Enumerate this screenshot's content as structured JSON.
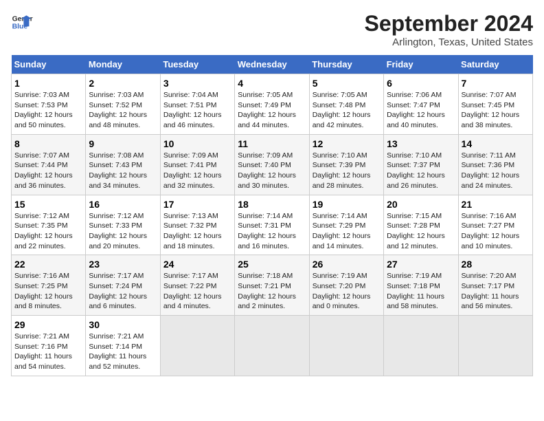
{
  "logo": {
    "line1": "General",
    "line2": "Blue"
  },
  "title": "September 2024",
  "subtitle": "Arlington, Texas, United States",
  "headers": [
    "Sunday",
    "Monday",
    "Tuesday",
    "Wednesday",
    "Thursday",
    "Friday",
    "Saturday"
  ],
  "weeks": [
    [
      {
        "day": "1",
        "info": "Sunrise: 7:03 AM\nSunset: 7:53 PM\nDaylight: 12 hours\nand 50 minutes."
      },
      {
        "day": "2",
        "info": "Sunrise: 7:03 AM\nSunset: 7:52 PM\nDaylight: 12 hours\nand 48 minutes."
      },
      {
        "day": "3",
        "info": "Sunrise: 7:04 AM\nSunset: 7:51 PM\nDaylight: 12 hours\nand 46 minutes."
      },
      {
        "day": "4",
        "info": "Sunrise: 7:05 AM\nSunset: 7:49 PM\nDaylight: 12 hours\nand 44 minutes."
      },
      {
        "day": "5",
        "info": "Sunrise: 7:05 AM\nSunset: 7:48 PM\nDaylight: 12 hours\nand 42 minutes."
      },
      {
        "day": "6",
        "info": "Sunrise: 7:06 AM\nSunset: 7:47 PM\nDaylight: 12 hours\nand 40 minutes."
      },
      {
        "day": "7",
        "info": "Sunrise: 7:07 AM\nSunset: 7:45 PM\nDaylight: 12 hours\nand 38 minutes."
      }
    ],
    [
      {
        "day": "8",
        "info": "Sunrise: 7:07 AM\nSunset: 7:44 PM\nDaylight: 12 hours\nand 36 minutes."
      },
      {
        "day": "9",
        "info": "Sunrise: 7:08 AM\nSunset: 7:43 PM\nDaylight: 12 hours\nand 34 minutes."
      },
      {
        "day": "10",
        "info": "Sunrise: 7:09 AM\nSunset: 7:41 PM\nDaylight: 12 hours\nand 32 minutes."
      },
      {
        "day": "11",
        "info": "Sunrise: 7:09 AM\nSunset: 7:40 PM\nDaylight: 12 hours\nand 30 minutes."
      },
      {
        "day": "12",
        "info": "Sunrise: 7:10 AM\nSunset: 7:39 PM\nDaylight: 12 hours\nand 28 minutes."
      },
      {
        "day": "13",
        "info": "Sunrise: 7:10 AM\nSunset: 7:37 PM\nDaylight: 12 hours\nand 26 minutes."
      },
      {
        "day": "14",
        "info": "Sunrise: 7:11 AM\nSunset: 7:36 PM\nDaylight: 12 hours\nand 24 minutes."
      }
    ],
    [
      {
        "day": "15",
        "info": "Sunrise: 7:12 AM\nSunset: 7:35 PM\nDaylight: 12 hours\nand 22 minutes."
      },
      {
        "day": "16",
        "info": "Sunrise: 7:12 AM\nSunset: 7:33 PM\nDaylight: 12 hours\nand 20 minutes."
      },
      {
        "day": "17",
        "info": "Sunrise: 7:13 AM\nSunset: 7:32 PM\nDaylight: 12 hours\nand 18 minutes."
      },
      {
        "day": "18",
        "info": "Sunrise: 7:14 AM\nSunset: 7:31 PM\nDaylight: 12 hours\nand 16 minutes."
      },
      {
        "day": "19",
        "info": "Sunrise: 7:14 AM\nSunset: 7:29 PM\nDaylight: 12 hours\nand 14 minutes."
      },
      {
        "day": "20",
        "info": "Sunrise: 7:15 AM\nSunset: 7:28 PM\nDaylight: 12 hours\nand 12 minutes."
      },
      {
        "day": "21",
        "info": "Sunrise: 7:16 AM\nSunset: 7:27 PM\nDaylight: 12 hours\nand 10 minutes."
      }
    ],
    [
      {
        "day": "22",
        "info": "Sunrise: 7:16 AM\nSunset: 7:25 PM\nDaylight: 12 hours\nand 8 minutes."
      },
      {
        "day": "23",
        "info": "Sunrise: 7:17 AM\nSunset: 7:24 PM\nDaylight: 12 hours\nand 6 minutes."
      },
      {
        "day": "24",
        "info": "Sunrise: 7:17 AM\nSunset: 7:22 PM\nDaylight: 12 hours\nand 4 minutes."
      },
      {
        "day": "25",
        "info": "Sunrise: 7:18 AM\nSunset: 7:21 PM\nDaylight: 12 hours\nand 2 minutes."
      },
      {
        "day": "26",
        "info": "Sunrise: 7:19 AM\nSunset: 7:20 PM\nDaylight: 12 hours\nand 0 minutes."
      },
      {
        "day": "27",
        "info": "Sunrise: 7:19 AM\nSunset: 7:18 PM\nDaylight: 11 hours\nand 58 minutes."
      },
      {
        "day": "28",
        "info": "Sunrise: 7:20 AM\nSunset: 7:17 PM\nDaylight: 11 hours\nand 56 minutes."
      }
    ],
    [
      {
        "day": "29",
        "info": "Sunrise: 7:21 AM\nSunset: 7:16 PM\nDaylight: 11 hours\nand 54 minutes."
      },
      {
        "day": "30",
        "info": "Sunrise: 7:21 AM\nSunset: 7:14 PM\nDaylight: 11 hours\nand 52 minutes."
      },
      null,
      null,
      null,
      null,
      null
    ]
  ]
}
